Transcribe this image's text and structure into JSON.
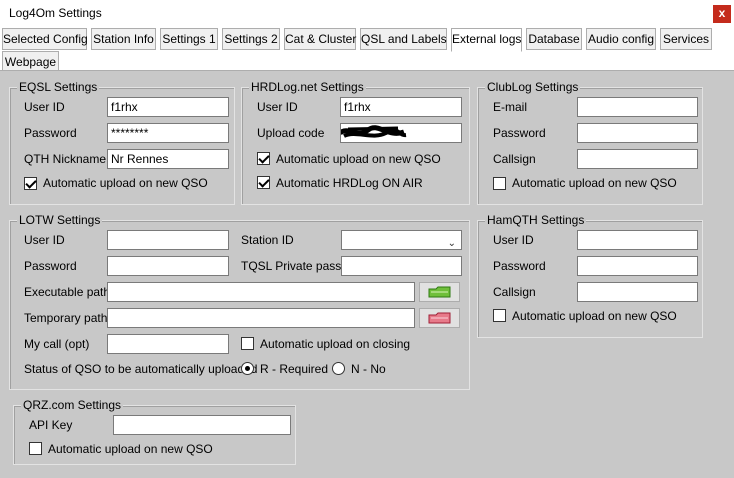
{
  "window": {
    "title": "Log4Om Settings",
    "close_glyph": "x"
  },
  "tabs": [
    "Selected Config",
    "Station Info",
    "Settings 1",
    "Settings 2",
    "Cat & Cluster",
    "QSL and Labels",
    "External logs",
    "Database",
    "Audio config",
    "Services",
    "Webpage"
  ],
  "active_tab": "External logs",
  "eqsl": {
    "legend": "EQSL Settings",
    "user_id_label": "User ID",
    "user_id": "f1rhx",
    "password_label": "Password",
    "password": "********",
    "qth_label": "QTH Nickname",
    "qth": "Nr Rennes",
    "auto_label": "Automatic upload on new QSO",
    "auto": true
  },
  "hrdlog": {
    "legend": "HRDLog.net Settings",
    "user_id_label": "User ID",
    "user_id": "f1rhx",
    "upload_code_label": "Upload code",
    "auto_label": "Automatic upload on new QSO",
    "auto": true,
    "onair_label": "Automatic HRDLog ON AIR",
    "onair": true
  },
  "clublog": {
    "legend": "ClubLog Settings",
    "email_label": "E-mail",
    "email": "",
    "password_label": "Password",
    "password": "",
    "callsign_label": "Callsign",
    "callsign": "",
    "auto_label": "Automatic upload on new QSO",
    "auto": false
  },
  "lotw": {
    "legend": "LOTW Settings",
    "user_id_label": "User ID",
    "user_id": "",
    "station_id_label": "Station ID",
    "station_id": "",
    "password_label": "Password",
    "password": "",
    "tqsl_label": "TQSL Private pass",
    "tqsl": "",
    "exe_label": "Executable path",
    "exe": "",
    "temp_label": "Temporary path",
    "temp": "",
    "mycall_label": "My call (opt)",
    "mycall": "",
    "auto_close_label": "Automatic upload on closing",
    "auto_close": false,
    "status_label": "Status of QSO to be automatically uploaded",
    "status_required_label": "R - Required",
    "status_no_label": "N - No",
    "status_selected": "R - Required"
  },
  "hamqth": {
    "legend": "HamQTH Settings",
    "user_id_label": "User ID",
    "user_id": "",
    "password_label": "Password",
    "password": "",
    "callsign_label": "Callsign",
    "callsign": "",
    "auto_label": "Automatic upload on new QSO",
    "auto": false
  },
  "qrz": {
    "legend": "QRZ.com Settings",
    "api_key_label": "API Key",
    "api_key": "",
    "auto_label": "Automatic upload on new QSO",
    "auto": false
  },
  "colors": {
    "panel": "#c8c8c8",
    "close": "#c42b1c",
    "tab_active": "#ffffff"
  },
  "icons": {
    "exe_browse": "green-folder-icon",
    "temp_browse": "red-folder-icon"
  }
}
